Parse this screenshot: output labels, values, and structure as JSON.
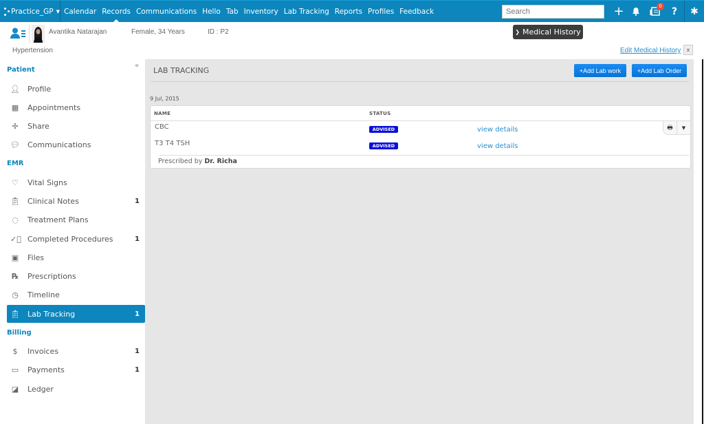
{
  "topnav": {
    "brand": "Practice_GP",
    "links": [
      "Calendar",
      "Records",
      "Communications",
      "Hello",
      "Tab",
      "Inventory",
      "Lab Tracking",
      "Reports",
      "Profiles",
      "Feedback"
    ],
    "active_link": "Records",
    "search_placeholder": "Search",
    "icons": [
      "plus-icon",
      "bell-icon",
      "inbox-icon",
      "help-icon",
      "gear-icon"
    ],
    "notification_count": "0",
    "color": "#0d86bd"
  },
  "patient": {
    "name": "Avantika Natarajan",
    "gender_age": "Female, 34 Years",
    "id": "ID : P2",
    "condition": "Hypertension",
    "medical_history_button": "Medical History",
    "edit_medical_history": "Edit Medical History",
    "close_label": "x"
  },
  "sidebar": {
    "sections": [
      {
        "title": "Patient",
        "items": [
          {
            "label": "Profile",
            "icon": "profile-icon",
            "count": ""
          },
          {
            "label": "Appointments",
            "icon": "calendar-icon",
            "count": ""
          },
          {
            "label": "Share",
            "icon": "share-icon",
            "count": ""
          },
          {
            "label": "Communications",
            "icon": "chat-icon",
            "count": ""
          }
        ]
      },
      {
        "title": "EMR",
        "items": [
          {
            "label": "Vital Signs",
            "icon": "heart-icon",
            "count": ""
          },
          {
            "label": "Clinical Notes",
            "icon": "clipboard-icon",
            "count": "1"
          },
          {
            "label": "Treatment Plans",
            "icon": "dotted-circle-icon",
            "count": ""
          },
          {
            "label": "Completed Procedures",
            "icon": "check-circle-icon",
            "count": "1"
          },
          {
            "label": "Files",
            "icon": "image-icon",
            "count": ""
          },
          {
            "label": "Prescriptions",
            "icon": "rx-icon",
            "count": ""
          },
          {
            "label": "Timeline",
            "icon": "clock-icon",
            "count": ""
          },
          {
            "label": "Lab Tracking",
            "icon": "clipboard-icon",
            "count": "1",
            "active": true
          }
        ]
      },
      {
        "title": "Billing",
        "items": [
          {
            "label": "Invoices",
            "icon": "invoice-icon",
            "count": "1"
          },
          {
            "label": "Payments",
            "icon": "payment-icon",
            "count": "1"
          },
          {
            "label": "Ledger",
            "icon": "ledger-icon",
            "count": ""
          }
        ]
      }
    ]
  },
  "main": {
    "title": "LAB TRACKING",
    "add_lab_work": "+Add Lab work",
    "add_lab_order": "+Add Lab Order",
    "date": "9 Jul, 2015",
    "columns": [
      "NAME",
      "STATUS"
    ],
    "rows": [
      {
        "name": "CBC",
        "status": "ADVISED",
        "link": "view details"
      },
      {
        "name": "T3 T4 TSH",
        "status": "ADVISED",
        "link": "view details"
      }
    ],
    "prescribed_by_label": "Prescribed by",
    "prescribed_by": "Dr. Richa"
  }
}
